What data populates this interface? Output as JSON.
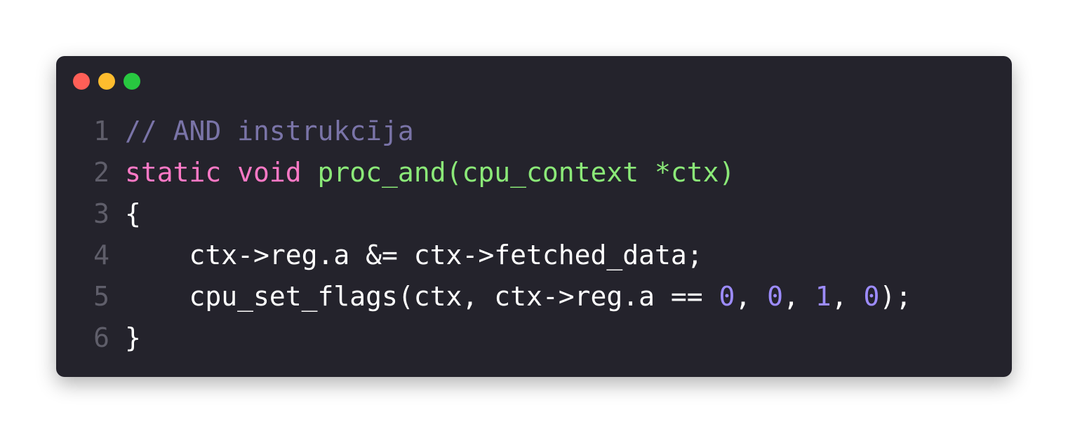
{
  "colors": {
    "background": "#ffffff",
    "window": "#24232c",
    "dot_close": "#ff5f57",
    "dot_minimize": "#febc2e",
    "dot_zoom": "#28c840",
    "line_number": "#5f5e6a",
    "comment": "#7a74a8",
    "keyword": "#ff79c6",
    "function": "#8be978",
    "number": "#9d8cff",
    "plain": "#ffffff"
  },
  "window_controls": [
    "close",
    "minimize",
    "zoom"
  ],
  "code": {
    "lines": [
      {
        "num": "1",
        "tokens": [
          {
            "t": "// AND instrukcīja",
            "k": "comment"
          }
        ]
      },
      {
        "num": "2",
        "tokens": [
          {
            "t": "static void ",
            "k": "keyword"
          },
          {
            "t": "proc_and(cpu_context *ctx)",
            "k": "function"
          }
        ]
      },
      {
        "num": "3",
        "tokens": [
          {
            "t": "{",
            "k": "plain"
          }
        ]
      },
      {
        "num": "4",
        "tokens": [
          {
            "t": "    ctx->reg.a &= ctx->fetched_data;",
            "k": "plain"
          }
        ]
      },
      {
        "num": "5",
        "tokens": [
          {
            "t": "    cpu_set_flags(ctx, ctx->reg.a == ",
            "k": "plain"
          },
          {
            "t": "0",
            "k": "number"
          },
          {
            "t": ", ",
            "k": "plain"
          },
          {
            "t": "0",
            "k": "number"
          },
          {
            "t": ", ",
            "k": "plain"
          },
          {
            "t": "1",
            "k": "number"
          },
          {
            "t": ", ",
            "k": "plain"
          },
          {
            "t": "0",
            "k": "number"
          },
          {
            "t": ");",
            "k": "plain"
          }
        ]
      },
      {
        "num": "6",
        "tokens": [
          {
            "t": "}",
            "k": "plain"
          }
        ]
      }
    ]
  }
}
